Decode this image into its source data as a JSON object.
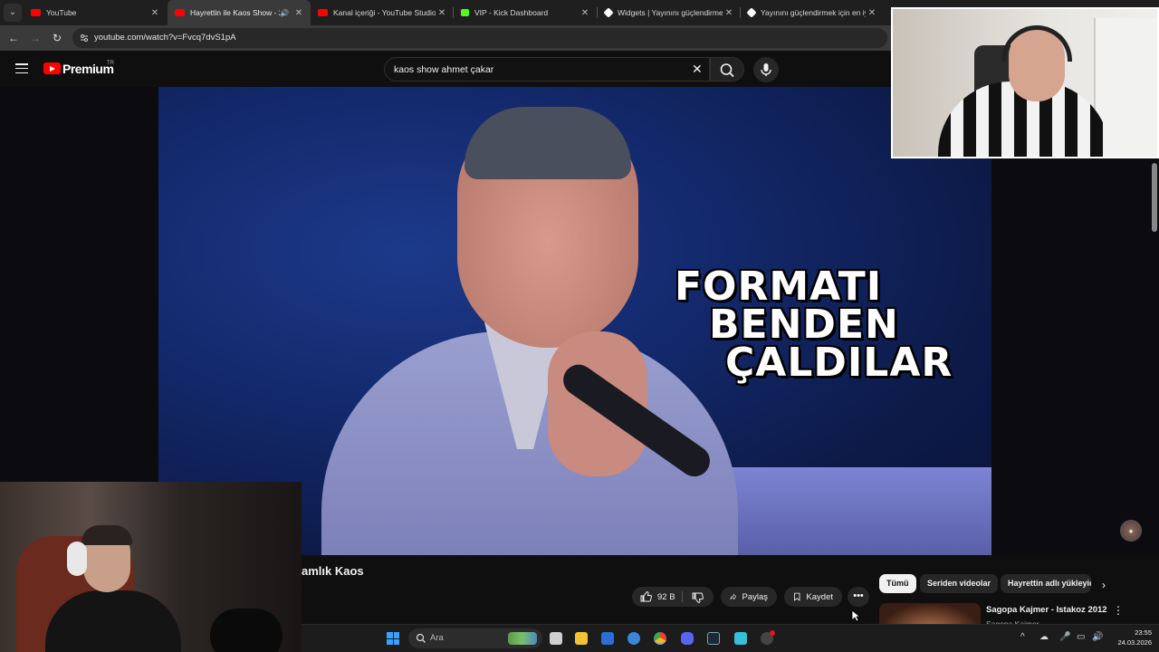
{
  "tabs": [
    {
      "title": "YouTube",
      "favicon_color": "#ff0000"
    },
    {
      "title": "Hayrettin ile Kaos Show - 2...",
      "favicon_color": "#ff0000",
      "active": true
    },
    {
      "title": "Kanal içeriği - YouTube Studio",
      "favicon_color": "#ff0000"
    },
    {
      "title": "VIP - Kick Dashboard",
      "favicon_color": "#53fc18"
    },
    {
      "title": "Widgets | Yayınını güçlendirmek",
      "favicon_color": "#ffffff"
    },
    {
      "title": "Yayınını güçlendirmek için en iy",
      "favicon_color": "#ffffff"
    }
  ],
  "address": {
    "url": "youtube.com/watch?v=Fvcq7dvS1pA"
  },
  "yt": {
    "brand": "Premium",
    "country": "TR",
    "search_query": "kaos show ahmet çakar"
  },
  "video": {
    "overlay_line1": "FORMATI",
    "overlay_line2": "BENDEN",
    "overlay_line3": "ÇALDILAR",
    "title": "amlık Kaos"
  },
  "actions": {
    "likes": "92 B",
    "share": "Paylaş",
    "save": "Kaydet"
  },
  "chips": [
    "Tümü",
    "Seriden videolar",
    "Hayrettin adlı yükleyic"
  ],
  "recommendation": {
    "title": "Sagopa Kajmer - Istakoz 2012",
    "channel": "Sagopa Kajmer"
  },
  "taskbar": {
    "search_placeholder": "Ara",
    "time": "23:55",
    "date": "24.03.2026"
  },
  "colors": {
    "accent": "#ff0000",
    "background": "#0f0f0f"
  }
}
